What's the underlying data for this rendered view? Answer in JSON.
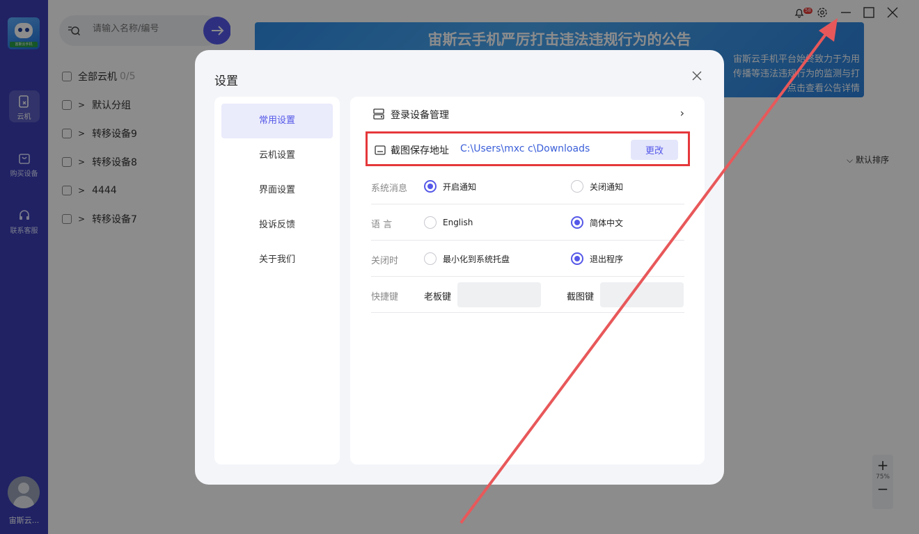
{
  "app": {
    "brand_logo_text": "宙斯云手机",
    "username": "宙斯云..."
  },
  "rail": {
    "items": [
      {
        "label": "云机"
      },
      {
        "label": "购买设备"
      },
      {
        "label": "联系客服"
      }
    ]
  },
  "sidebar": {
    "search_placeholder": "请输入名称/编号",
    "all_label": "全部云机",
    "all_count": "0/5",
    "groups": [
      {
        "label": "默认分组"
      },
      {
        "label": "转移设备9"
      },
      {
        "label": "转移设备8"
      },
      {
        "label": "4444"
      },
      {
        "label": "转移设备7"
      }
    ]
  },
  "banner": {
    "title": "宙斯云手机严厉打击违法违规行为的公告",
    "line1": "宙斯云手机平台始终致力于为用",
    "line2": "传播等违法违规行为的监测与打",
    "line3": "点击查看公告详情"
  },
  "main": {
    "sort_label": "默认排序",
    "zoom_level": "75%"
  },
  "window": {
    "notification_count": "58"
  },
  "settings": {
    "title": "设置",
    "nav": [
      "常用设置",
      "云机设置",
      "界面设置",
      "投诉反馈",
      "关于我们"
    ],
    "login_devices_label": "登录设备管理",
    "screenshot_label": "截图保存地址",
    "screenshot_path": "C:\\Users\\mxc  c\\Downloads",
    "change_button": "更改",
    "system_msg_label": "系统消息",
    "notify_on": "开启通知",
    "notify_off": "关闭通知",
    "language_label": "语  言",
    "lang_en": "English",
    "lang_zh": "简体中文",
    "close_label": "关闭时",
    "close_tray": "最小化到系统托盘",
    "close_exit": "退出程序",
    "hotkey_label": "快捷键",
    "boss_key": "老板键",
    "shot_key": "截图键"
  },
  "colors": {
    "rail": "#3b3fb6",
    "accent": "#5558e8",
    "highlight": "#e5383b"
  }
}
